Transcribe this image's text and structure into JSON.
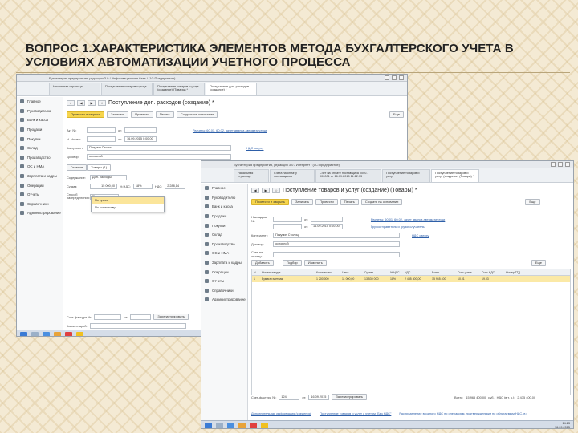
{
  "slide": {
    "title": "ВОПРОС 1.ХАРАКТЕРИСТИКА ЭЛЕМЕНТОВ МЕТОДА БУХГАЛТЕРСКОГО УЧЕТА В УСЛОВИЯХ АВТОМАТИЗАЦИИ УЧЕТНОГО ПРОЦЕССА"
  },
  "sidebar_items": [
    "Главное",
    "Руководителю",
    "Банк и касса",
    "Продажи",
    "Покупки",
    "Склад",
    "Производство",
    "ОС и НМА",
    "Зарплата и кадры",
    "Операции",
    "Отчеты",
    "Справочники",
    "Администрирование"
  ],
  "win1": {
    "titlebar": "Бухгалтерия предприятия, редакция 3.0 / Информационная база / (1С:Предприятие)",
    "tabs": [
      "Начальная страница",
      "Поступление товаров и услуг",
      "Поступление товаров и услуг (создание) (Товары) *",
      "Поступление доп. расходов (создание) *"
    ],
    "form_title": "Поступление доп. расходов (создание) *",
    "toolbar": {
      "post_close": "Провести и закрыть",
      "save": "Записать",
      "post": "Провести",
      "print": "Печать",
      "create_based": "Создать на основании",
      "more": "Еще"
    },
    "fields": {
      "doc_num_label": "Акт №:",
      "from_label": "от:",
      "date": "16.09.2015 0:00:00",
      "invoice_label": "Н. Номер:",
      "contractor_label": "Контрагент:",
      "contractor": "Пакунин Столиц",
      "contract_label": "Договор:",
      "contract": "основной",
      "accounts_link": "Расчеты: 60.01, 60.02, зачет аванса автоматически",
      "vat_link": "НДС сверху"
    },
    "inner_tabs": [
      "Главное",
      "Товары (1)"
    ],
    "content_label": "Содержание:",
    "content_value": "Доп. расходы",
    "sum_label": "Сумма:",
    "sum_value": "15 000,00",
    "vat_rate_label": "% НДС:",
    "vat_rate": "18%",
    "vat_label": "НДС:",
    "vat_value": "2 288,14",
    "distribution_label": "Способ распределения:",
    "distribution_value": "По сумме",
    "dropdown_options": [
      "По сумме",
      "По количеству"
    ],
    "invoice_footer_label": "Счет-фактура №:",
    "invoice_footer_from": "от:",
    "register_btn": "Зарегистрировать",
    "comment_label": "Комментарий:"
  },
  "win2": {
    "titlebar": "Бухгалтерия предприятия, редакция 3.0 / Интернет / (1С:Предприятие)",
    "tabs": [
      "Начальная страница",
      "Счета на оплату поставщиков",
      "Счет на оплату поставщика 0000-000001 от 16.09.2015 11:22:13",
      "Поступление товаров и услуг",
      "Поступление товаров и услуг (создание) (Товары) *"
    ],
    "form_title": "Поступление товаров и услуг (создание) (Товары) *",
    "toolbar": {
      "post_close": "Провести и закрыть",
      "save": "Записать",
      "post": "Провести",
      "print": "Печать",
      "create_based": "Создать на основании",
      "more": "Еще"
    },
    "fields": {
      "doc_label": "Накладная №:",
      "from_label": "от:",
      "date": "16.09.2015 0:00:00",
      "accounts_link": "Расчеты: 60.01, 60.02, зачет аванса автоматически",
      "goods_link": "Грузоотправитель и грузополучатель",
      "vat_link": "НДС сверху",
      "contractor_label": "Контрагент:",
      "contractor": "Пакунин Столиц",
      "contract_label": "Договор:",
      "contract": "основной",
      "invoice_label": "Счет на оплату:"
    },
    "grid_toolbar": {
      "add": "Добавить",
      "select": "Подбор",
      "change": "Изменить",
      "more": "Еще"
    },
    "grid_columns": [
      "N",
      "Номенклатура",
      "Количество",
      "Цена",
      "Сумма",
      "% НДС",
      "НДС",
      "Всего",
      "Счет учета",
      "Счет НДС",
      "Номер ГТД"
    ],
    "grid_rows": [
      [
        "1",
        "Бумага газетная",
        "1 200,000",
        "11 000,00",
        "13 530 000",
        "18%",
        "2 435 400,00",
        "15 965 400",
        "10.01",
        "19.03",
        ""
      ]
    ],
    "footer": {
      "invoice_label": "Счет-фактура №:",
      "invoice_num": "124",
      "from_label": "от:",
      "invoice_date": "16.09.2015",
      "register_btn": "Зарегистрировать",
      "total_label": "Всего:",
      "total_value": "15 965 400,00",
      "currency": "руб.",
      "vat_total_label": "НДС (в т. ч.):",
      "vat_total_value": "2 435 400,00",
      "link_left": "Дополнительная информация (сведения)",
      "link_mid": "Поступление товаров и услуг с учетом \"Без НДС\"",
      "link_right": "Распределение входного НДС по операциям, подтвержденным по облагаемым НДС, в целях НДС, участки"
    },
    "clock_time": "14:23",
    "clock_date": "16.09.2015"
  }
}
